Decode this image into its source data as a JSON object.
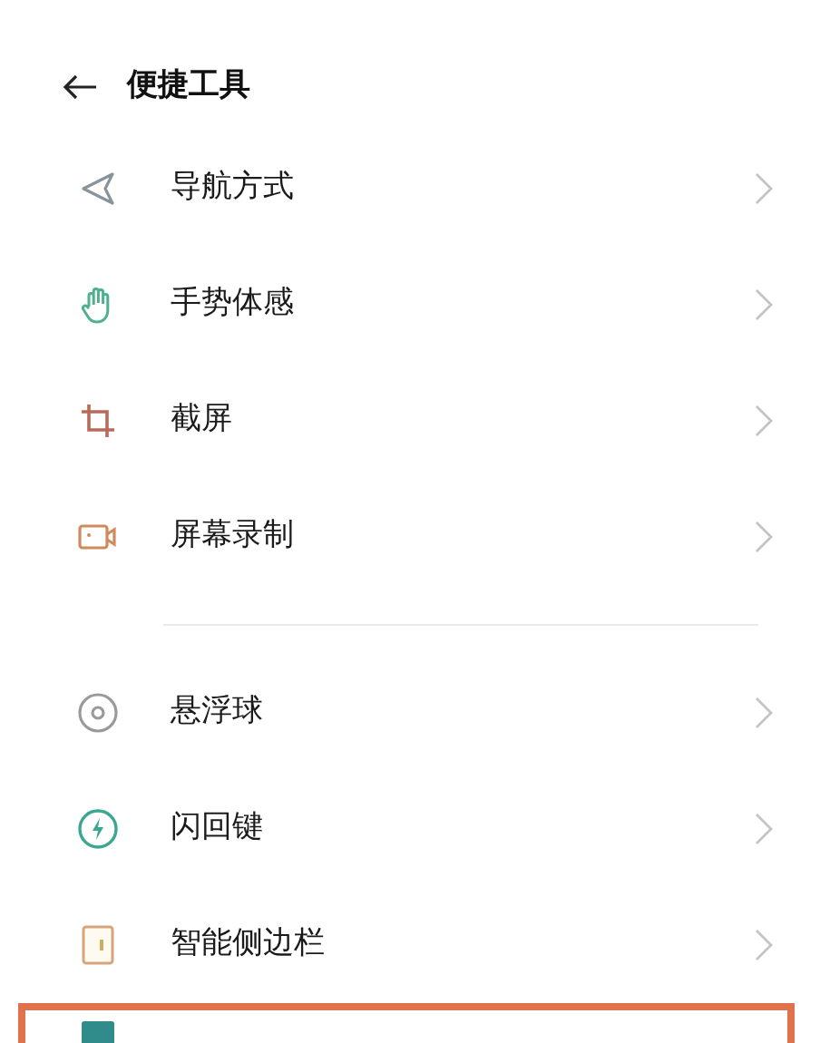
{
  "header": {
    "title": "便捷工具"
  },
  "groups": [
    {
      "items": [
        {
          "label": "导航方式",
          "highlighted": false
        },
        {
          "label": "手势体感",
          "highlighted": false
        },
        {
          "label": "截屏",
          "highlighted": false
        },
        {
          "label": "屏幕录制",
          "highlighted": false
        }
      ]
    },
    {
      "items": [
        {
          "label": "悬浮球",
          "highlighted": false
        },
        {
          "label": "闪回键",
          "highlighted": false
        },
        {
          "label": "智能侧边栏",
          "highlighted": false
        },
        {
          "highlighted": true
        }
      ]
    }
  ]
}
